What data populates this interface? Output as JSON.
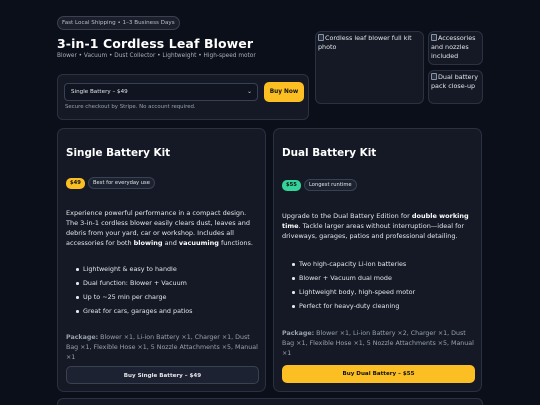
{
  "header": {
    "shipping_pill": "Fast Local Shipping • 1–3 Business Days",
    "title": "3-in-1 Cordless Leaf Blower",
    "subtitle": "Blower • Vacuum • Dust Collector • Lightweight • High-speed motor"
  },
  "buy": {
    "selected_option": "Single Battery – $49",
    "buy_now_label": "Buy Now",
    "secure_note": "Secure checkout by Stripe. No account required."
  },
  "gallery": {
    "main_alt": "Cordless leaf blower full kit photo",
    "thumb1_alt": "Accessories and nozzles included",
    "thumb2_alt": "Dual battery pack close-up"
  },
  "cards": [
    {
      "title": "Single Battery Kit",
      "price": "$49",
      "tag": "Best for everyday use",
      "desc_pre": "Experience powerful performance in a compact design. The 3-in-1 cordless blower easily clears dust, leaves and debris from your yard, car or workshop. Includes all accessories for both ",
      "desc_b1": "blowing",
      "desc_mid": " and ",
      "desc_b2": "vacuuming",
      "desc_post": " functions.",
      "features": [
        "Lightweight & easy to handle",
        "Dual function: Blower + Vacuum",
        "Up to ~25 min per charge",
        "Great for cars, garages and patios"
      ],
      "package_label": "Package:",
      "package_text": " Blower ×1, Li-ion Battery ×1, Charger ×1, Dust Bag ×1, Flexible Hose ×1, 5 Nozzle Attachments ×5, Manual ×1",
      "cta": "Buy Single Battery – $49",
      "accent": "#fbbf24"
    },
    {
      "title": "Dual Battery Kit",
      "price": "$55",
      "tag": "Longest runtime",
      "desc_pre": "Upgrade to the Dual Battery Edition for ",
      "desc_b1": "double working time",
      "desc_post": ". Tackle larger areas without interruption—ideal for driveways, garages, patios and professional detailing.",
      "features": [
        "Two high-capacity Li-ion batteries",
        "Blower + Vacuum dual mode",
        "Lightweight body, high-speed motor",
        "Perfect for heavy-duty cleaning"
      ],
      "package_label": "Package:",
      "package_text": " Blower ×1, Li-ion Battery ×2, Charger ×1, Dust Bag ×1, Flexible Hose ×1, 5 Nozzle Attachments ×5, Manual ×1",
      "cta": "Buy Dual Battery – $55",
      "accent": "#34d399"
    }
  ]
}
